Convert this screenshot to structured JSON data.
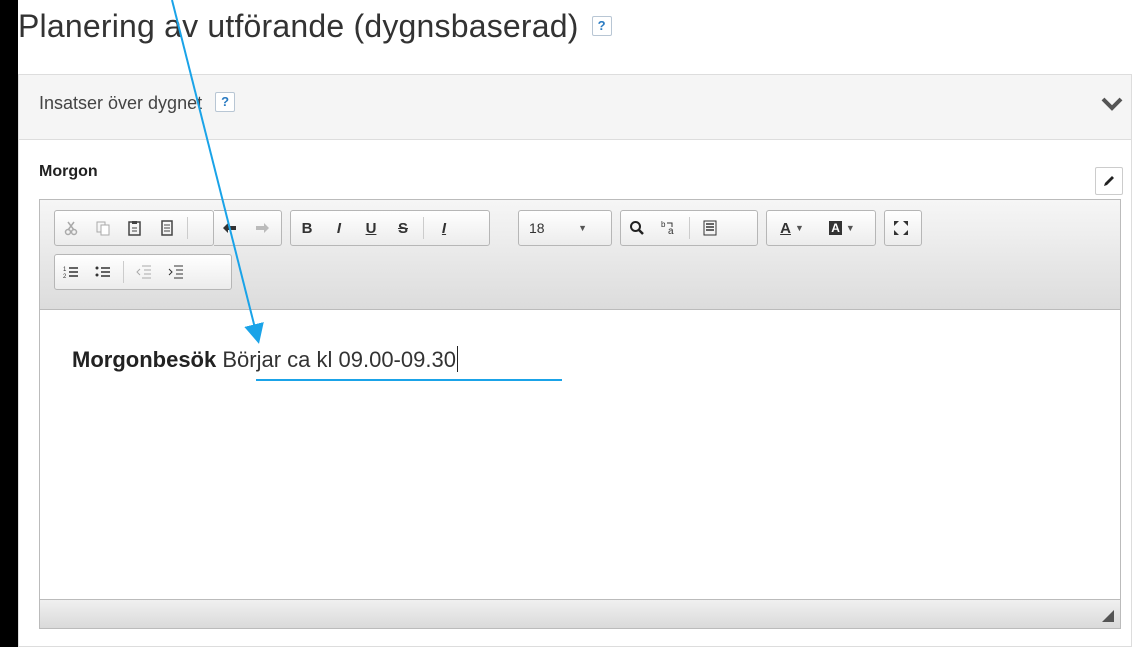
{
  "page": {
    "title": "Planering av utförande (dygnsbaserad)",
    "help_label": "?"
  },
  "panel": {
    "header_label": "Insatser över dygnet",
    "help_label": "?"
  },
  "field": {
    "label": "Morgon"
  },
  "toolbar": {
    "font_size_value": "18",
    "row1": [
      {
        "group": "clipboard",
        "buttons": [
          "cut-icon",
          "copy-icon",
          "paste-icon",
          "paste-text-icon"
        ],
        "disabled": [
          "cut-icon",
          "copy-icon"
        ]
      },
      {
        "group": "history",
        "buttons": [
          "undo-icon",
          "redo-icon"
        ],
        "disabled": [
          "redo-icon"
        ]
      },
      {
        "group": "basic-styles",
        "buttons": [
          "bold",
          "italic",
          "underline",
          "strike",
          "remove-format"
        ]
      },
      {
        "group": "font-size",
        "buttons": [
          "font-size-select"
        ]
      },
      {
        "group": "find",
        "buttons": [
          "find-icon",
          "replace-icon",
          "select-all-icon"
        ]
      },
      {
        "group": "colors",
        "buttons": [
          "text-color",
          "background-color"
        ]
      },
      {
        "group": "tools",
        "buttons": [
          "maximize-icon"
        ]
      }
    ],
    "row2": [
      {
        "group": "lists",
        "buttons": [
          "numbered-list-icon",
          "bulleted-list-icon",
          "decrease-indent-icon",
          "increase-indent-icon"
        ]
      }
    ],
    "glyphs": {
      "bold": "B",
      "italic": "I",
      "underline": "U",
      "strike": "S",
      "remove_format": "I",
      "text_color": "A",
      "bg_color": "A"
    }
  },
  "editor": {
    "bold_text": "Morgonbesök",
    "plain_text": "Börjar ca kl 09.00-09.30"
  },
  "colors": {
    "annotation": "#1aa3e8",
    "help_text": "#2a7bc2"
  }
}
